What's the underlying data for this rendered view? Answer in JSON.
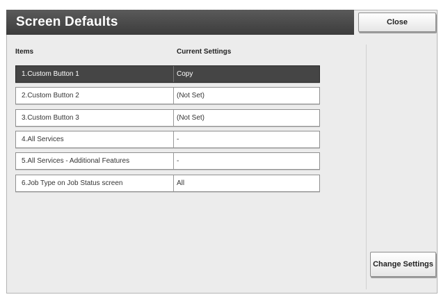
{
  "header": {
    "title": "Screen Defaults",
    "close_label": "Close"
  },
  "table": {
    "col_items": "Items",
    "col_settings": "Current Settings",
    "rows": [
      {
        "item": "1.Custom Button 1",
        "value": "Copy",
        "selected": true
      },
      {
        "item": "2.Custom Button 2",
        "value": "(Not Set)",
        "selected": false
      },
      {
        "item": "3.Custom Button 3",
        "value": "(Not Set)",
        "selected": false
      },
      {
        "item": "4.All Services",
        "value": "-",
        "selected": false
      },
      {
        "item": "5.All Services - Additional Features",
        "value": "-",
        "selected": false
      },
      {
        "item": "6.Job Type on Job Status screen",
        "value": "All",
        "selected": false
      }
    ]
  },
  "actions": {
    "change_settings_label": "Change Settings"
  },
  "colors": {
    "selected_row": "#454545",
    "titlebar": "#4a4a4a",
    "panel": "#ececec"
  }
}
